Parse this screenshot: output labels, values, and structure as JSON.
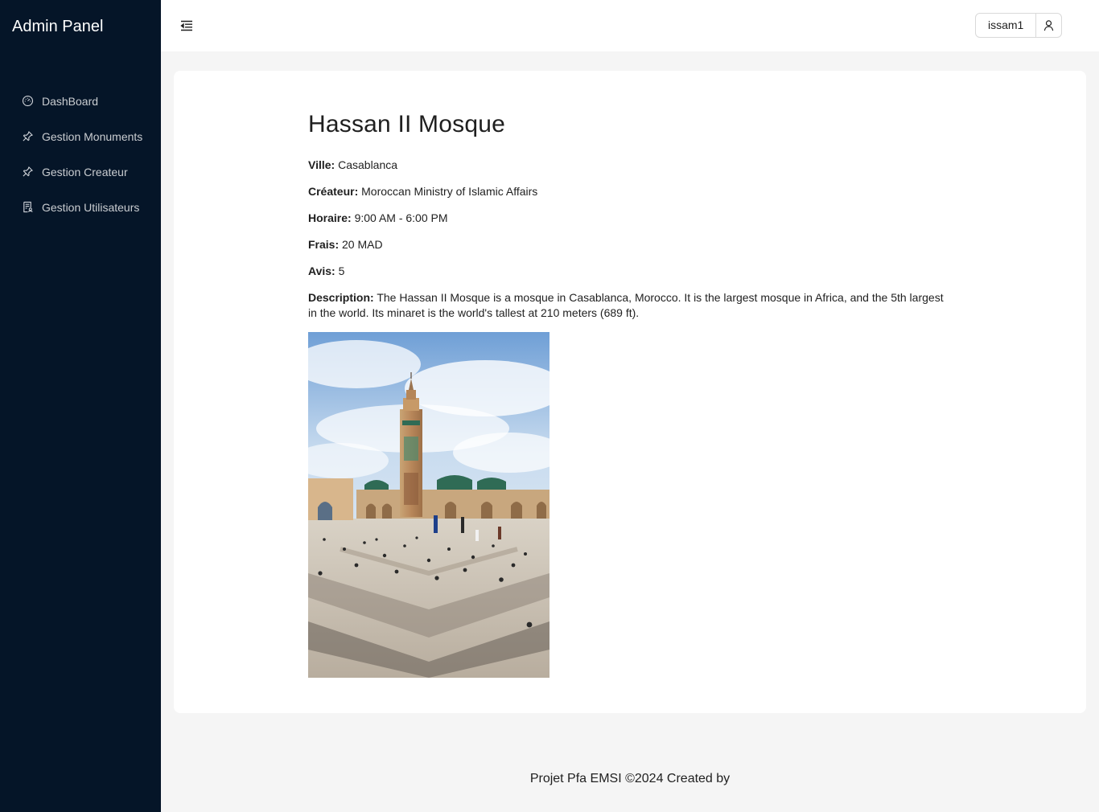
{
  "sidebar": {
    "title": "Admin Panel",
    "items": [
      {
        "label": "DashBoard",
        "icon": "dashboard-icon"
      },
      {
        "label": "Gestion Monuments",
        "icon": "pushpin-icon"
      },
      {
        "label": "Gestion Createur",
        "icon": "pushpin-icon"
      },
      {
        "label": "Gestion Utilisateurs",
        "icon": "user-list-icon"
      }
    ]
  },
  "header": {
    "menu_toggle_icon": "menu-fold-icon",
    "username": "issam1",
    "user_icon": "user-icon"
  },
  "monument": {
    "title": "Hassan II Mosque",
    "ville_label": "Ville:",
    "ville": "Casablanca",
    "createur_label": "Créateur:",
    "createur": "Moroccan Ministry of Islamic Affairs",
    "horaire_label": "Horaire:",
    "horaire": "9:00 AM - 6:00 PM",
    "frais_label": "Frais:",
    "frais": "20 MAD",
    "avis_label": "Avis:",
    "avis": "5",
    "description_label": "Description:",
    "description": "The Hassan II Mosque is a mosque in Casablanca, Morocco. It is the largest mosque in Africa, and the 5th largest in the world. Its minaret is the world's tallest at 210 meters (689 ft)."
  },
  "footer": {
    "text": "Projet Pfa EMSI ©2024 Created by"
  }
}
